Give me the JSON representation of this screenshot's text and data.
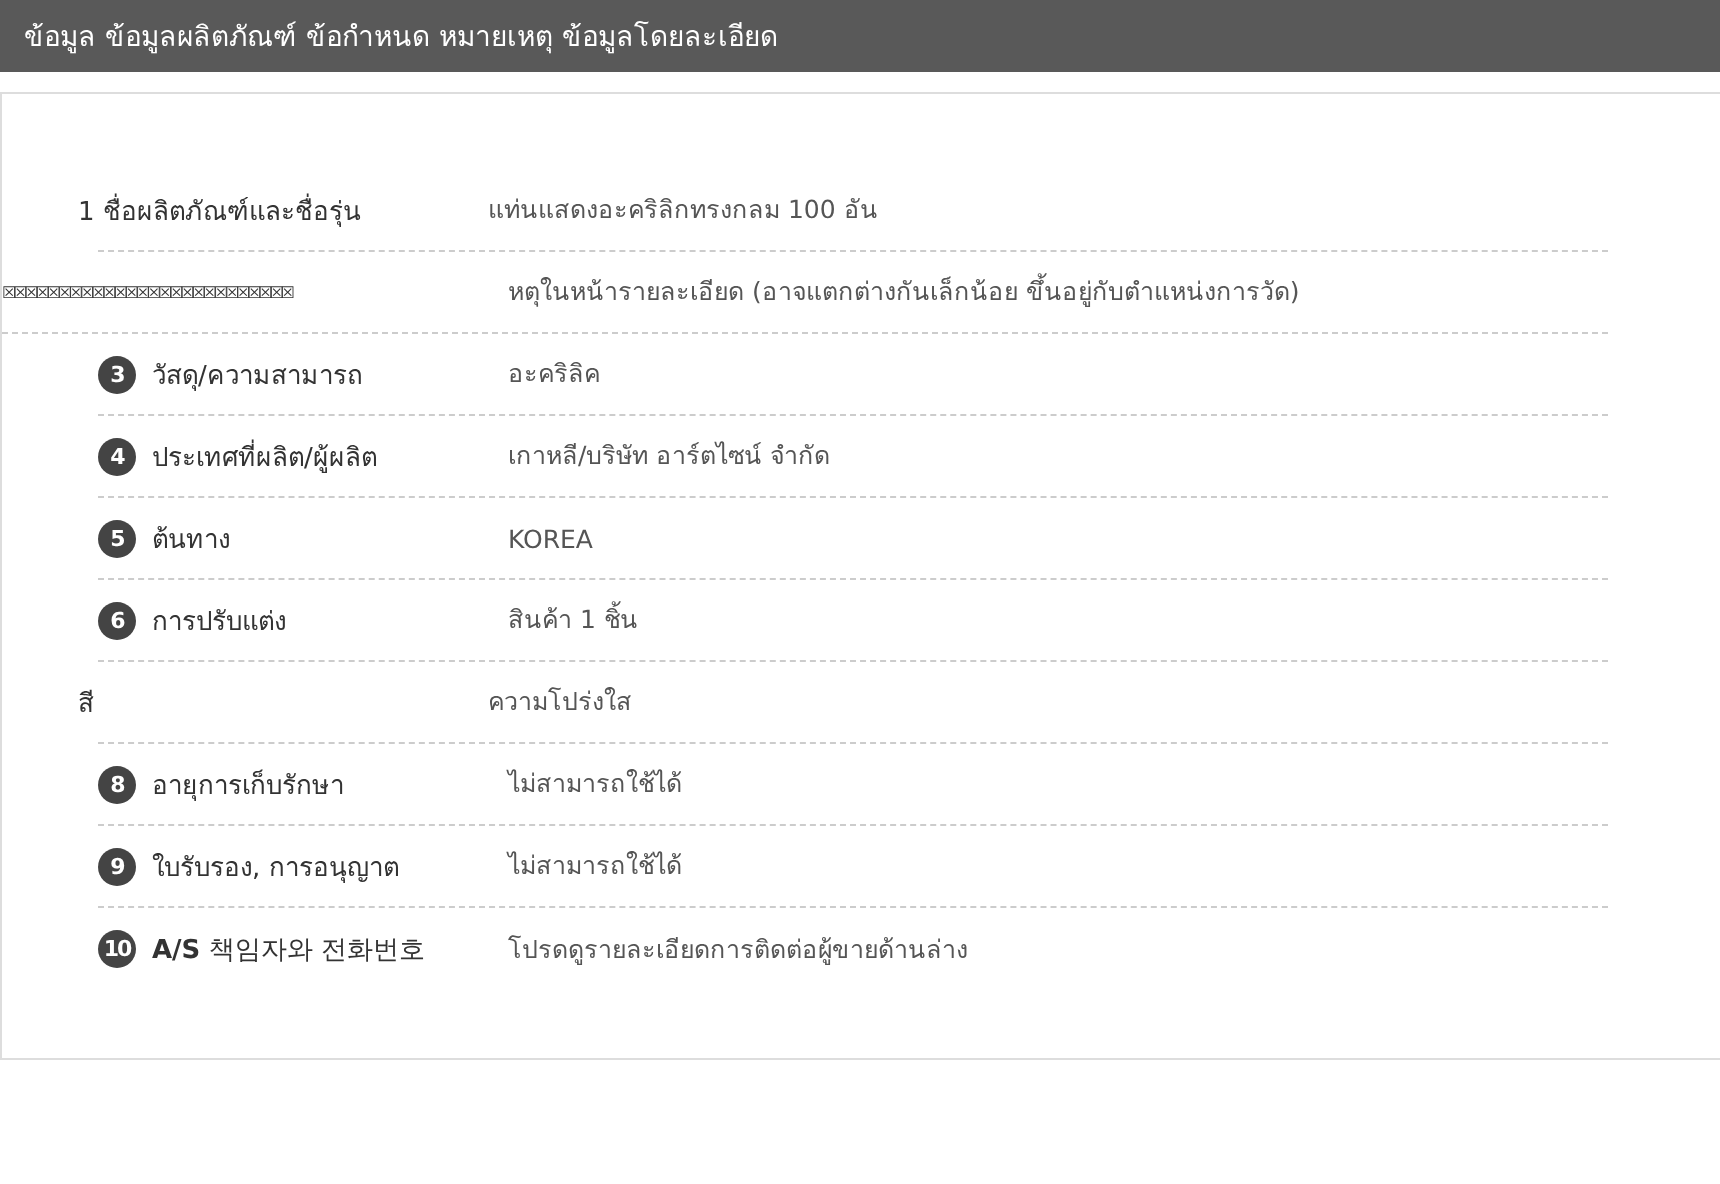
{
  "header": {
    "title": "ข้อมูล ข้อมูลผลิตภัณฑ์ ข้อกำหนด หมายเหตุ ข้อมูลโดยละเอียด"
  },
  "rows": [
    {
      "kind": "plain",
      "label": "1 ชื่อผลิตภัณฑ์และชื่อรุ่น",
      "value": "แท่นแสดงอะคริลิกทรงกลม 100 อัน"
    },
    {
      "kind": "broken",
      "label": "☒☒☒☒☒☒☒☒☒☒☒☒☒☒☒☒☒☒☒☒☒☒☒☒☒☒",
      "value": "หตุในหน้ารายละเอียด (อาจแตกต่างกันเล็กน้อย ขึ้นอยู่กับตำแหน่งการวัด)"
    },
    {
      "kind": "numbered",
      "number": "3",
      "label": "วัสดุ/ความสามารถ",
      "value": "อะคริลิค"
    },
    {
      "kind": "numbered",
      "number": "4",
      "label": "ประเทศที่ผลิต/ผู้ผลิต",
      "value": "เกาหลี/บริษัท อาร์ตไซน์ จำกัด"
    },
    {
      "kind": "numbered",
      "number": "5",
      "label": "ต้นทาง",
      "value": "KOREA"
    },
    {
      "kind": "numbered",
      "number": "6",
      "label": "การปรับแต่ง",
      "value": "สินค้า 1 ชิ้น"
    },
    {
      "kind": "plain",
      "label": "สี",
      "value": "ความโปร่งใส"
    },
    {
      "kind": "numbered",
      "number": "8",
      "label": "อายุการเก็บรักษา",
      "value": "ไม่สามารถใช้ได้"
    },
    {
      "kind": "numbered",
      "number": "9",
      "label": "ใบรับรอง, การอนุญาต",
      "value": "ไม่สามารถใช้ได้"
    },
    {
      "kind": "numbered",
      "number": "10",
      "label": "**A/S** 책임자와 전화번호",
      "value": "โปรดดูรายละเอียดการติดต่อผู้ขายด้านล่าง"
    }
  ]
}
